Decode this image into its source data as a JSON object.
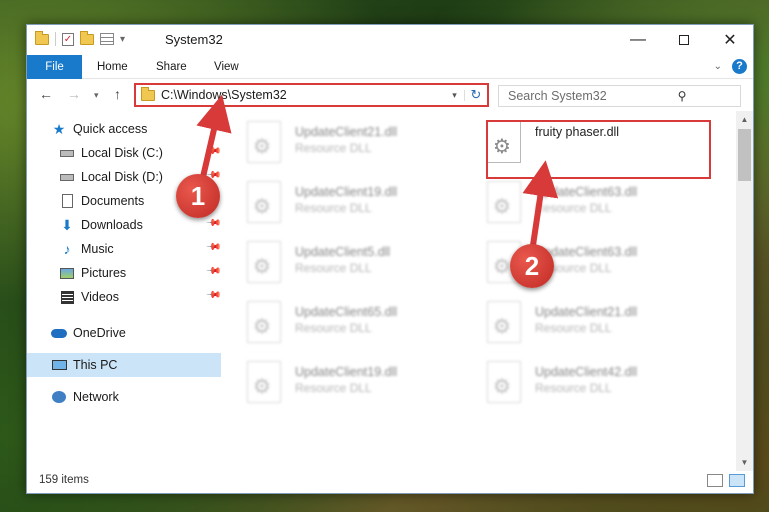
{
  "window": {
    "title": "System32"
  },
  "ribbon": {
    "tabs": [
      "File",
      "Home",
      "Share",
      "View"
    ]
  },
  "address": {
    "path": "C:\\Windows\\System32",
    "search_placeholder": "Search System32"
  },
  "sidebar": {
    "items": [
      {
        "label": "Quick access",
        "icon": "star-icon",
        "pinned": false
      },
      {
        "label": "Local Disk (C:)",
        "icon": "drive-icon",
        "pinned": true
      },
      {
        "label": "Local Disk (D:)",
        "icon": "drive-icon",
        "pinned": true
      },
      {
        "label": "Documents",
        "icon": "documents-icon",
        "pinned": true
      },
      {
        "label": "Downloads",
        "icon": "downloads-icon",
        "pinned": true
      },
      {
        "label": "Music",
        "icon": "music-icon",
        "pinned": true
      },
      {
        "label": "Pictures",
        "icon": "pictures-icon",
        "pinned": true
      },
      {
        "label": "Videos",
        "icon": "videos-icon",
        "pinned": true
      },
      {
        "label": "OneDrive",
        "icon": "onedrive-icon",
        "pinned": false
      },
      {
        "label": "This PC",
        "icon": "this-pc-icon",
        "pinned": false,
        "selected": true
      },
      {
        "label": "Network",
        "icon": "network-icon",
        "pinned": false
      }
    ]
  },
  "files": {
    "highlighted": {
      "name": "fruity phaser.dll"
    },
    "items": [
      {
        "name": "UpdateClient21.dll",
        "type": "Resource DLL"
      },
      {
        "name": "UpdateClient19.dll",
        "type": "Resource DLL"
      },
      {
        "name": "UpdateClient63.dll",
        "type": "Resource DLL"
      },
      {
        "name": "UpdateClient5.dll",
        "type": "Resource DLL"
      },
      {
        "name": "UpdateClient63.dll",
        "type": "Resource DLL"
      },
      {
        "name": "UpdateClient65.dll",
        "type": "Resource DLL"
      },
      {
        "name": "UpdateClient21.dll",
        "type": "Resource DLL"
      },
      {
        "name": "UpdateClient19.dll",
        "type": "Resource DLL"
      },
      {
        "name": "UpdateClient42.dll",
        "type": "Resource DLL"
      }
    ]
  },
  "status": {
    "count": "159 items"
  },
  "annotations": {
    "badge1": "1",
    "badge2": "2",
    "color": "#d83a3a"
  }
}
